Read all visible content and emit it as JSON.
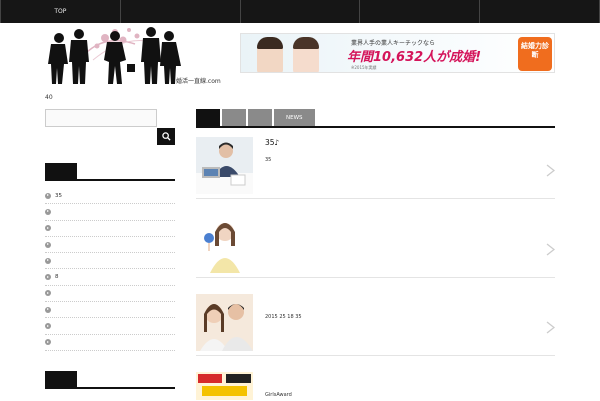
{
  "nav": [
    "TOP",
    "",
    "",
    "",
    ""
  ],
  "logo": {
    "caption": "婚活一直線.com"
  },
  "banner": {
    "line1": "業界人手の業人キーチックなら",
    "main": "年間10,632人が成婚!",
    "note": "※2015年実績",
    "button": "結婚力診断"
  },
  "site": {
    "description": "40"
  },
  "sidebar": {
    "recent_heading": "",
    "items": [
      "35",
      "",
      "",
      "",
      "",
      "8",
      "",
      "",
      "",
      ""
    ],
    "heading2": ""
  },
  "tabs": [
    "",
    "",
    "",
    "NEWS"
  ],
  "posts": [
    {
      "title": "35♪",
      "excerpt": "35"
    },
    {
      "title": "",
      "excerpt": ""
    },
    {
      "title": "",
      "excerpt": "2015 25 18 35"
    },
    {
      "title": "",
      "excerpt": "GirlsAward"
    }
  ],
  "colors": {
    "nav": "#161616",
    "accent": "#d4145a",
    "tab_active": "#111111",
    "tab_inactive": "#8a8a8a",
    "cta": "#f06d1e"
  }
}
